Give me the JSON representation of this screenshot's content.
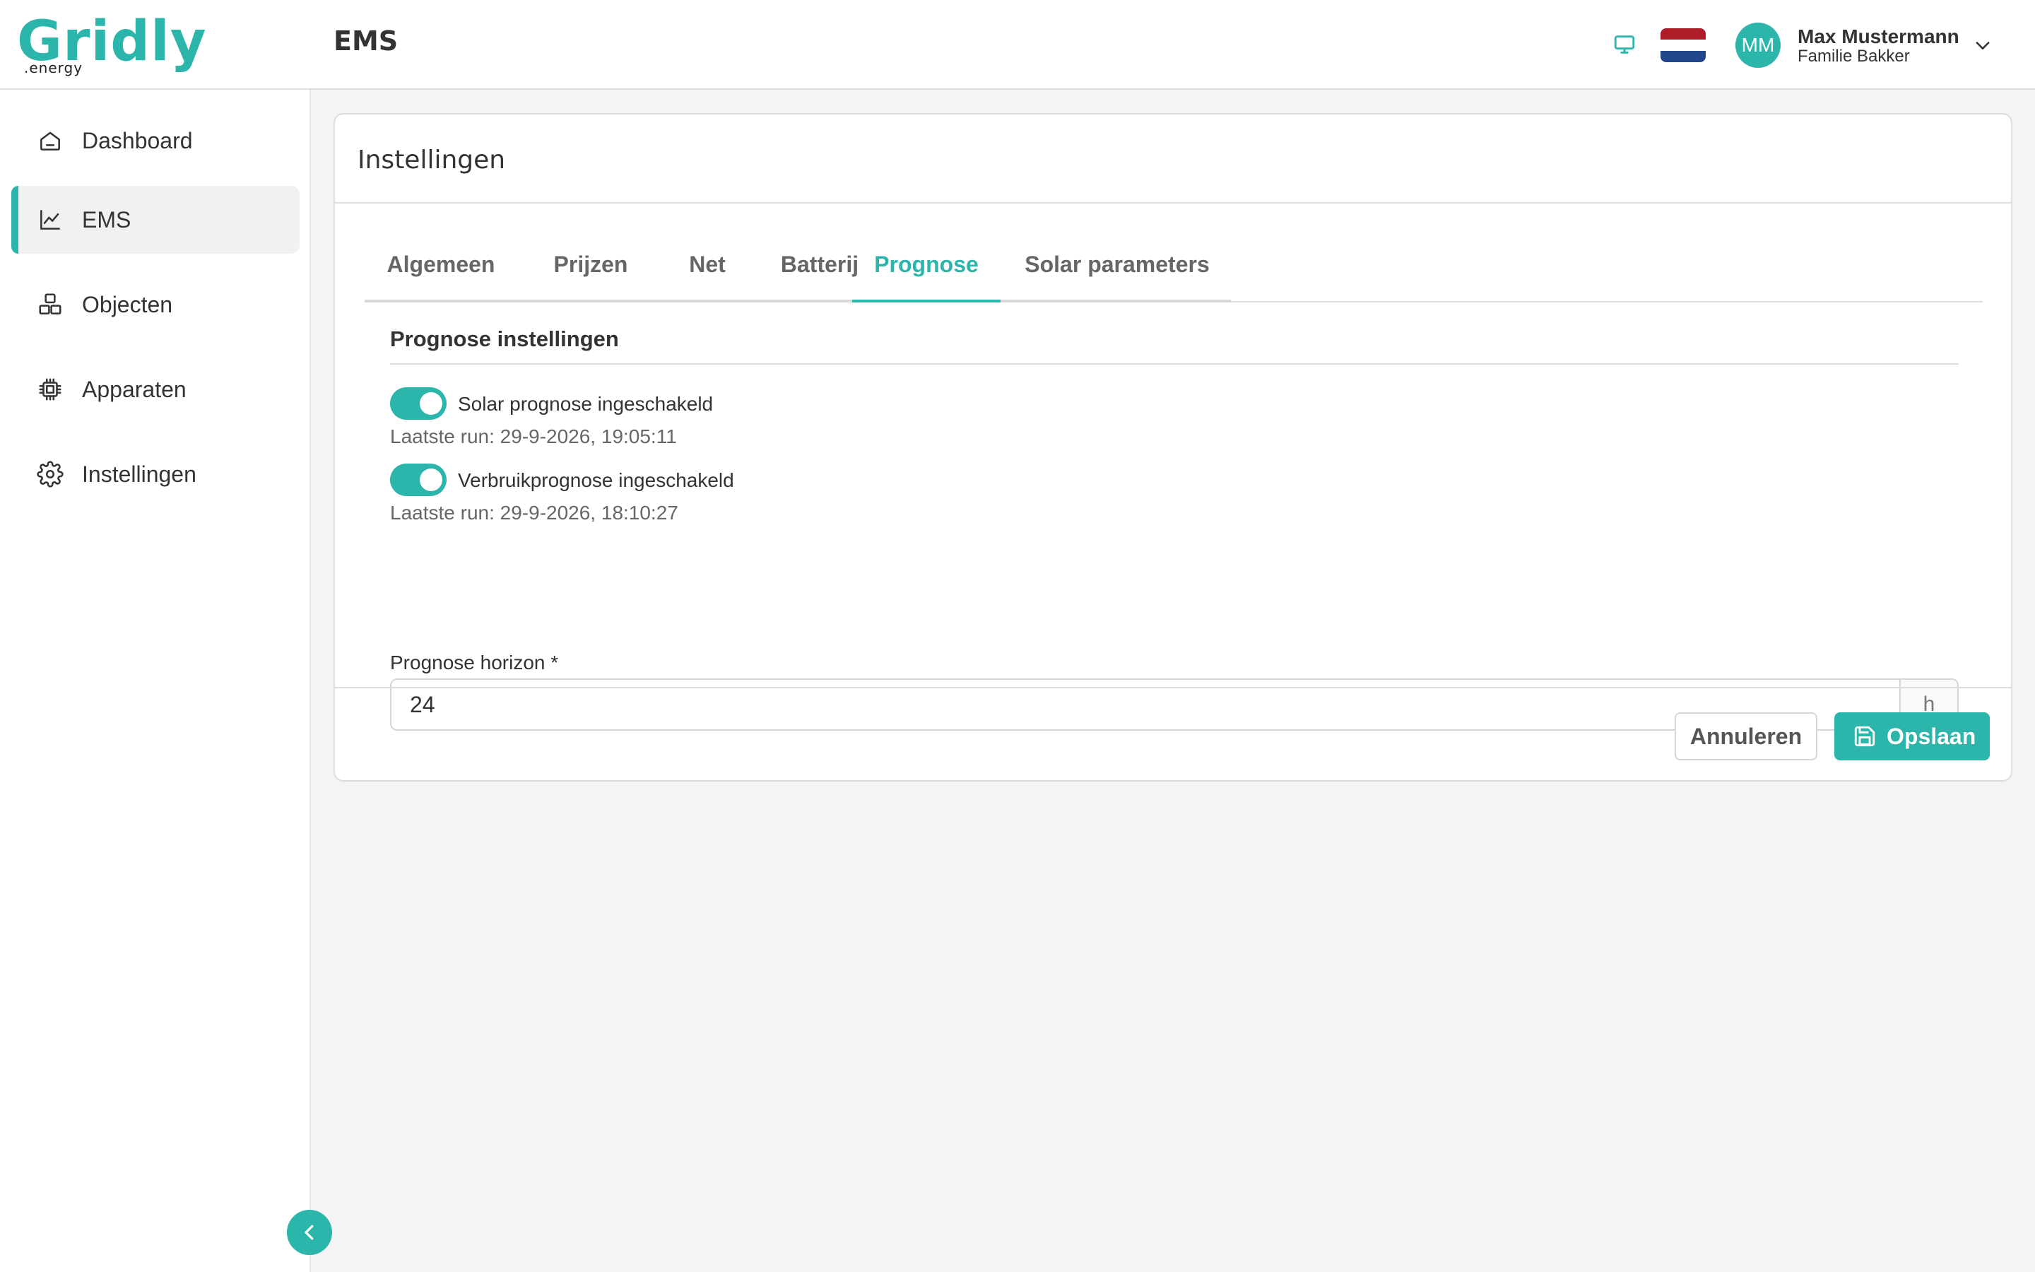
{
  "brand": {
    "name": "Gridly",
    "suffix": ".energy",
    "accent": "#2bb5ab"
  },
  "header": {
    "page_title": "EMS",
    "icons": [
      "monitor-icon",
      "flag-nl-icon"
    ],
    "user": {
      "initials": "MM",
      "name": "Max Mustermann",
      "organization": "Familie Bakker"
    }
  },
  "sidebar": {
    "items": [
      {
        "label": "Dashboard",
        "icon": "home-icon",
        "active": false
      },
      {
        "label": "EMS",
        "icon": "chart-line-icon",
        "active": true
      },
      {
        "label": "Objecten",
        "icon": "objects-icon",
        "active": false
      },
      {
        "label": "Apparaten",
        "icon": "chip-icon",
        "active": false
      },
      {
        "label": "Instellingen",
        "icon": "gear-icon",
        "active": false
      }
    ]
  },
  "card": {
    "title": "Instellingen",
    "tabs": [
      {
        "label": "Algemeen",
        "active": false
      },
      {
        "label": "Prijzen",
        "active": false
      },
      {
        "label": "Net",
        "active": false
      },
      {
        "label": "Batterij",
        "active": false
      },
      {
        "label": "Prognose",
        "active": true
      },
      {
        "label": "Solar parameters",
        "active": false
      }
    ],
    "section_title": "Prognose instellingen",
    "toggles": [
      {
        "label": "Solar prognose ingeschakeld",
        "enabled": true,
        "last_run": "Laatste run: 29-9-2026, 19:05:11"
      },
      {
        "label": "Verbruikprognose ingeschakeld",
        "enabled": true,
        "last_run": "Laatste run: 29-9-2026, 18:10:27"
      }
    ],
    "horizon": {
      "label": "Prognose horizon *",
      "value": "24",
      "unit": "h"
    },
    "footer": {
      "cancel_label": "Annuleren",
      "save_label": "Opslaan"
    }
  }
}
